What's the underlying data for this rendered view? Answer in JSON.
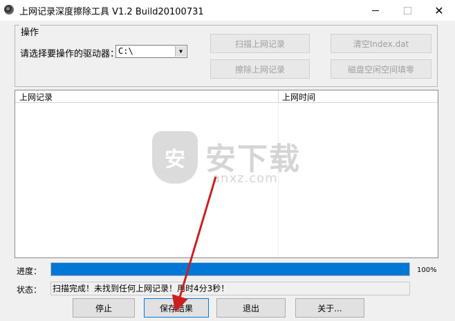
{
  "window": {
    "title": "上网记录深度擦除工具 V1.2   Build20100731",
    "minimize_icon": "minimize-icon",
    "maximize_icon": "maximize-icon",
    "close_icon": "close-icon"
  },
  "operation_group": {
    "title": "操作",
    "drive_label": "请选择要操作的驱动器：",
    "drive_value": "C:\\",
    "buttons": {
      "scan": "扫描上网记录",
      "clear_index": "清空Index.dat",
      "erase": "擦除上网记录",
      "wipe_free": "磁盘空闲空间填零"
    }
  },
  "records_list": {
    "columns": [
      "上网记录",
      "上网时间"
    ]
  },
  "watermark": {
    "text": "安下载",
    "sub": "anxz.com",
    "icon": "shield-logo-icon"
  },
  "progress": {
    "label": "进度：",
    "value": 100,
    "percent_text": "100%",
    "color": "#0078d7"
  },
  "status": {
    "label": "状态：",
    "text": "扫描完成！未找到任何上网记录！用时4分3秒！"
  },
  "bottom_buttons": {
    "stop": "停止",
    "save": "保存结果",
    "exit": "退出",
    "about": "关于..."
  },
  "annotation": {
    "color": "#cc1f1f"
  }
}
